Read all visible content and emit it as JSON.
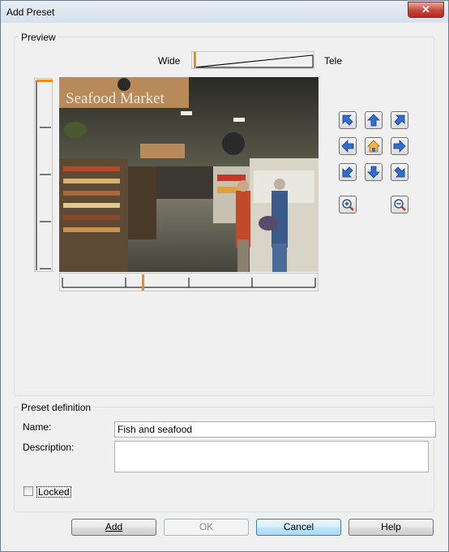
{
  "window": {
    "title": "Add Preset",
    "close_glyph": "✕"
  },
  "preview": {
    "group_label": "Preview",
    "zoom": {
      "wide_label": "Wide",
      "tele_label": "Tele",
      "level": 0.0
    },
    "camera_icon": "video-camera-preview-image",
    "controls": {
      "arrows": [
        "up-left",
        "up",
        "up-right",
        "left",
        "home",
        "right",
        "down-left",
        "down",
        "down-right"
      ],
      "zoom_in": "zoom-in-icon",
      "zoom_out": "zoom-out-icon"
    },
    "pan_level": 0.33,
    "tilt_level": 0.0
  },
  "preset": {
    "group_label": "Preset definition",
    "name_label": "Name:",
    "name_value": "Fish and seafood",
    "description_label": "Description:",
    "description_value": "",
    "locked_label": "Locked",
    "locked": false
  },
  "buttons": {
    "add": "Add",
    "ok": "OK",
    "cancel": "Cancel",
    "help": "Help"
  },
  "colors": {
    "accent": "#f08a1c",
    "default_button": "#3c7fb1",
    "arrow_blue": "#2f6fcf"
  }
}
